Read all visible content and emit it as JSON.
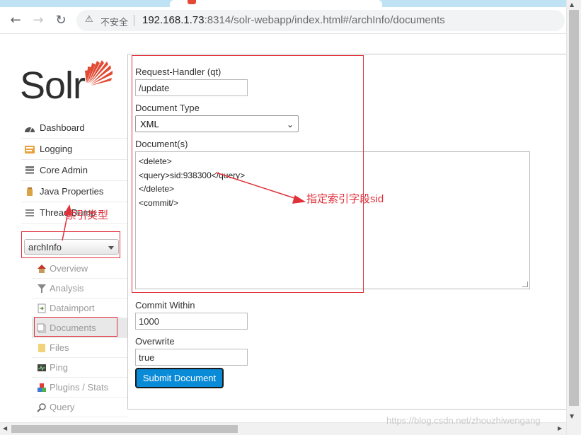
{
  "browser": {
    "url_security_label": "不安全",
    "url_host": "192.168.1.73",
    "url_port_path": ":8314/solr-webapp/index.html#/archInfo/documents"
  },
  "logo": {
    "text": "Solr"
  },
  "nav": {
    "items": [
      {
        "label": "Dashboard",
        "icon": "dashboard-icon"
      },
      {
        "label": "Logging",
        "icon": "logging-icon"
      },
      {
        "label": "Core Admin",
        "icon": "core-admin-icon"
      },
      {
        "label": "Java Properties",
        "icon": "java-properties-icon"
      },
      {
        "label": "Thread Dump",
        "icon": "thread-dump-icon"
      }
    ]
  },
  "core_selector": {
    "value": "archInfo"
  },
  "core_menu": {
    "items": [
      {
        "label": "Overview",
        "icon": "home-icon"
      },
      {
        "label": "Analysis",
        "icon": "filter-icon"
      },
      {
        "label": "Dataimport",
        "icon": "dataimport-icon"
      },
      {
        "label": "Documents",
        "icon": "documents-icon"
      },
      {
        "label": "Files",
        "icon": "folder-icon"
      },
      {
        "label": "Ping",
        "icon": "ping-icon"
      },
      {
        "label": "Plugins / Stats",
        "icon": "plugins-icon"
      },
      {
        "label": "Query",
        "icon": "magnifier-icon"
      }
    ]
  },
  "form": {
    "request_handler_label": "Request-Handler (qt)",
    "request_handler_value": "/update",
    "document_type_label": "Document Type",
    "document_type_value": "XML",
    "documents_label": "Document(s)",
    "documents_lines": [
      "<delete>",
      "<query>sid:938300</query>",
      "</delete>",
      "<commit/>"
    ],
    "commit_within_label": "Commit Within",
    "commit_within_value": "1000",
    "overwrite_label": "Overwrite",
    "overwrite_value": "true",
    "submit_label": "Submit Document"
  },
  "annotations": {
    "index_type_note": "索引类型",
    "sid_note": "指定索引字段sid"
  },
  "watermark": "https://blog.csdn.net/zhouzhiwengang",
  "colors": {
    "solr_red": "#e24a33",
    "submit_blue": "#0a8bd8",
    "annotation_red": "#e0313b"
  }
}
